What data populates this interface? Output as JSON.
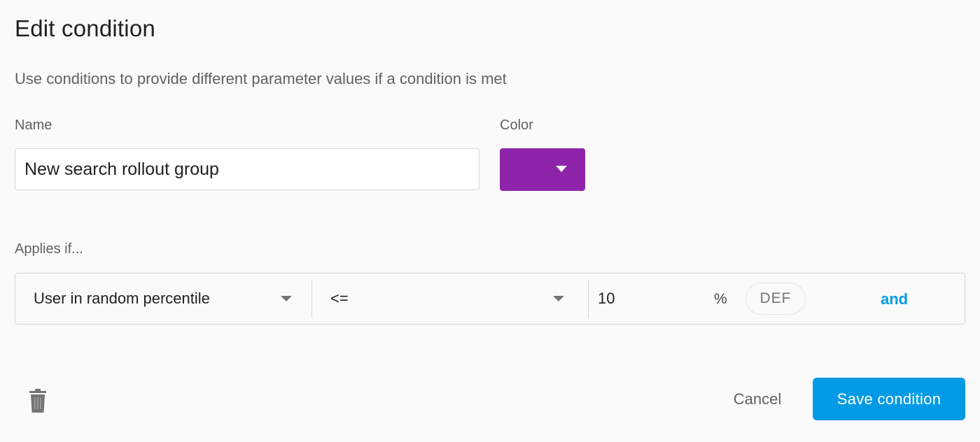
{
  "dialog": {
    "title": "Edit condition",
    "description": "Use conditions to provide different parameter values if a condition is met"
  },
  "form": {
    "name_label": "Name",
    "name_value": "New search rollout group",
    "color_label": "Color",
    "color_value": "#8e24aa",
    "applies_label": "Applies if..."
  },
  "condition": {
    "attribute": "User in random percentile",
    "operator": "<=",
    "value": "10",
    "unit": "%",
    "def_label": "DEF",
    "and_label": "and"
  },
  "actions": {
    "delete_icon": "trash-icon",
    "cancel_label": "Cancel",
    "save_label": "Save condition"
  },
  "colors": {
    "accent": "#039be5",
    "save_button": "#039be5",
    "condition_color": "#8e24aa"
  }
}
